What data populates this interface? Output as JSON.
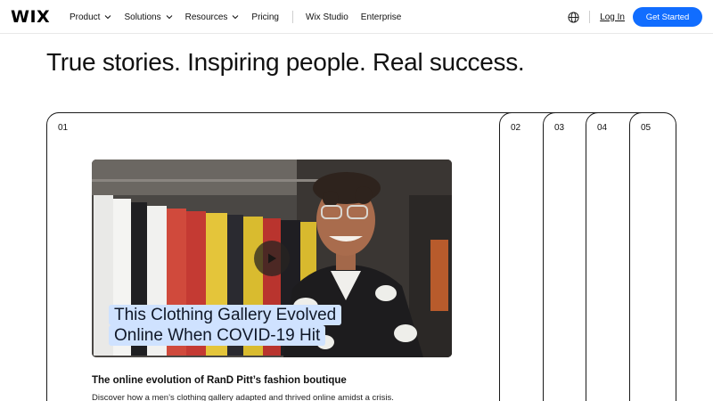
{
  "brand": {
    "logo_text": "WIX",
    "accent": "#116dff"
  },
  "nav": {
    "items": [
      {
        "label": "Product",
        "has_dropdown": true
      },
      {
        "label": "Solutions",
        "has_dropdown": true
      },
      {
        "label": "Resources",
        "has_dropdown": true
      },
      {
        "label": "Pricing",
        "has_dropdown": false
      }
    ],
    "secondary": [
      {
        "label": "Wix Studio"
      },
      {
        "label": "Enterprise"
      }
    ],
    "login_label": "Log In",
    "cta_label": "Get Started",
    "globe_icon": "globe-icon"
  },
  "hero": {
    "headline": "True stories. Inspiring people. Real success."
  },
  "stories": {
    "cards": [
      {
        "number": "01"
      },
      {
        "number": "02"
      },
      {
        "number": "03"
      },
      {
        "number": "04"
      },
      {
        "number": "05"
      }
    ],
    "active": {
      "caption_line1": "This Clothing Gallery Evolved",
      "caption_line2": "Online When COVID-19 Hit",
      "title": "The online evolution of RanD Pitt’s fashion boutique",
      "description": "Discover how a men’s clothing gallery adapted and thrived online amidst a crisis.",
      "play_icon": "play-icon"
    }
  }
}
